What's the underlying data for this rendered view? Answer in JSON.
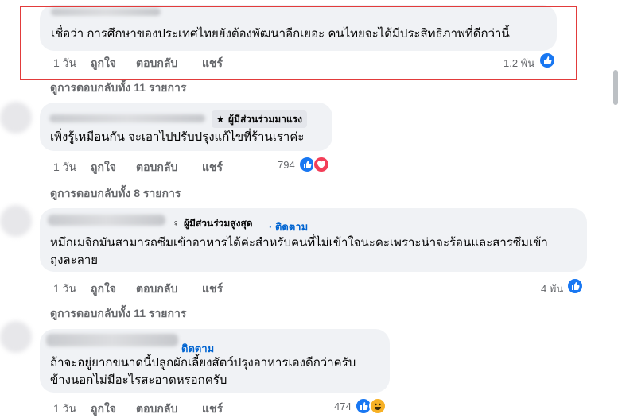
{
  "comment1": {
    "text": "เชื่อว่า การศึกษาของประเทศไทยยังต้องพัฒนาอีกเยอะ คนไทยจะได้มีประสิทธิภาพที่ดีกว่านี้",
    "time": "1 วัน",
    "like": "ถูกใจ",
    "reply": "ตอบกลับ",
    "share": "แชร์",
    "reactions": "1.2 พัน",
    "view_replies": "ดูการตอบกลับทั้ง 11 รายการ"
  },
  "comment2": {
    "badge": "ผู้มีส่วนร่วมมาแรง",
    "text": "เพิ่งรู้เหมือนกัน จะเอาไปปรับปรุงแก้ไขที่ร้านเราค่ะ",
    "time": "1 วัน",
    "like": "ถูกใจ",
    "reply": "ตอบกลับ",
    "share": "แชร์",
    "reactions": "794",
    "view_replies": "ดูการตอบกลับทั้ง 8 รายการ"
  },
  "comment3": {
    "badge": "ผู้มีส่วนร่วมสูงสุด",
    "follow": "· ติดตาม",
    "text_line1": "หมึกเมจิกมันสามารถซึมเข้าอาหารได้ค่ะสำหรับคนที่ไม่เข้าใจนะคะเพราะน่าจะร้อนและสารซึมเข้า",
    "text_line2": "ถุงละลาย",
    "time": "1 วัน",
    "like": "ถูกใจ",
    "reply": "ตอบกลับ",
    "share": "แชร์",
    "reactions": "4 พัน",
    "view_replies": "ดูการตอบกลับทั้ง 11 รายการ"
  },
  "comment4": {
    "follow": "ติดตาม",
    "text_line1": "ถ้าจะอยู่ยากขนาดนี้ปลูกผักเลี้ยงสัตว์ปรุงอาหารเองดีกว่าครับ",
    "text_line2": "ข้างนอกไม่มีอะไรสะอาดหรอกครับ",
    "time": "1 วัน",
    "like": "ถูกใจ",
    "reply": "ตอบกลับ",
    "share": "แชร์",
    "reactions": "474"
  },
  "colors": {
    "bubble": "#f0f2f5",
    "meta": "#65676b",
    "link": "#0064d1",
    "highlight": "#e23b3b",
    "like": "#1877f2",
    "love": "#f33e58",
    "haha": "#f7b125"
  },
  "icons": {
    "like": "like-reaction-icon",
    "love": "love-reaction-icon",
    "haha": "haha-reaction-icon",
    "badge_rising": "star-icon",
    "badge_top": "trophy-icon"
  }
}
